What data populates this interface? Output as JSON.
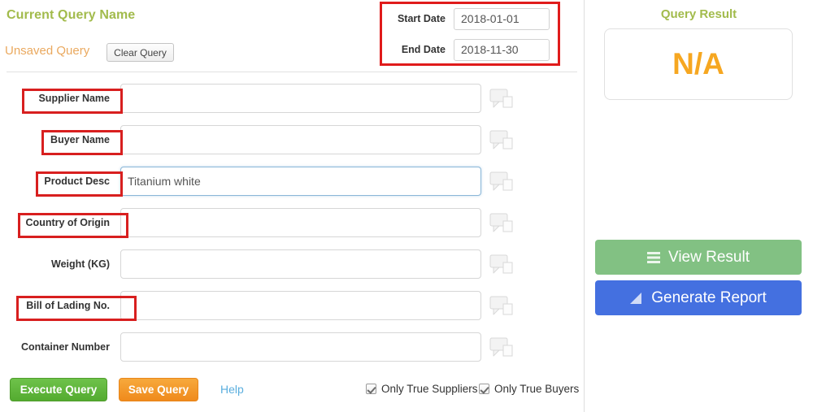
{
  "header": {
    "query_title": "Current Query Name",
    "query_state": "Unsaved Query",
    "clear_query_label": "Clear Query"
  },
  "dates": {
    "start_label": "Start Date",
    "start_value": "2018-01-01",
    "end_label": "End Date",
    "end_value": "2018-11-30"
  },
  "form": {
    "fields": [
      {
        "label": "Supplier Name",
        "value": "",
        "focused": false,
        "annotated": true,
        "icon": "comment-icon"
      },
      {
        "label": "Buyer Name",
        "value": "",
        "focused": false,
        "annotated": true,
        "icon": "comment-icon"
      },
      {
        "label": "Product Desc",
        "value": "Titanium white",
        "focused": true,
        "annotated": true,
        "icon": "comment-icon"
      },
      {
        "label": "Country of Origin",
        "value": "",
        "focused": false,
        "annotated": true,
        "icon": "comment-icon"
      },
      {
        "label": "Weight (KG)",
        "value": "",
        "focused": false,
        "annotated": false,
        "icon": "comment-icon"
      },
      {
        "label": "Bill of Lading No.",
        "value": "",
        "focused": false,
        "annotated": true,
        "icon": "comment-icon"
      },
      {
        "label": "Container Number",
        "value": "",
        "focused": false,
        "annotated": false,
        "icon": "comment-icon"
      }
    ]
  },
  "actions": {
    "execute_label": "Execute Query",
    "save_label": "Save Query",
    "help_label": "Help",
    "only_true_suppliers_label": "Only True Suppliers",
    "only_true_suppliers_checked": true,
    "only_true_buyers_label": "Only True Buyers",
    "only_true_buyers_checked": true
  },
  "result": {
    "title": "Query Result",
    "value": "N/A",
    "view_result_label": "View Result",
    "view_result_icon": "list-table-icon",
    "generate_report_label": "Generate Report",
    "generate_report_icon": "bar-chart-icon"
  },
  "colors": {
    "title_green": "#a2bb4c",
    "unsaved_orange": "#eaa95f",
    "result_orange": "#f6a721",
    "execute_green": "#5cb338",
    "save_orange": "#f0922b",
    "view_result_green": "#82c183",
    "generate_report_blue": "#4470e0",
    "annotation_red": "#d81f1f",
    "help_blue": "#5aaede"
  }
}
